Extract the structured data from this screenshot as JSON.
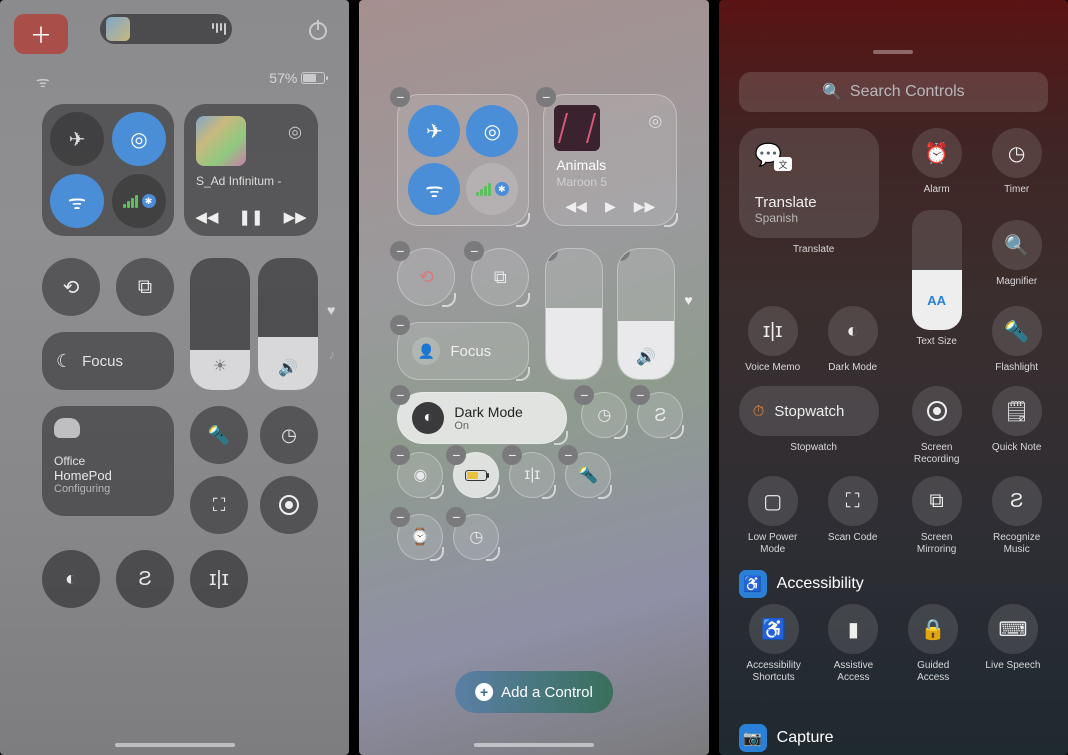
{
  "panel1": {
    "battery_percent": "57%",
    "media": {
      "title": "S_Ad Infinitum -"
    },
    "focus_label": "Focus",
    "home": {
      "room": "Office",
      "device": "HomePod",
      "status": "Configuring"
    }
  },
  "panel2": {
    "media": {
      "title": "Animals",
      "artist": "Maroon 5"
    },
    "focus_label": "Focus",
    "darkmode": {
      "title": "Dark Mode",
      "status": "On"
    },
    "add_control": "Add a Control"
  },
  "panel3": {
    "search_placeholder": "Search Controls",
    "translate": {
      "title": "Translate",
      "subtitle": "Spanish",
      "label": "Translate"
    },
    "items": {
      "alarm": "Alarm",
      "timer": "Timer",
      "magnifier": "Magnifier",
      "voice_memo": "Voice Memo",
      "dark_mode": "Dark Mode",
      "text_size": "Text Size",
      "text_size_glyph": "AA",
      "flashlight": "Flashlight",
      "stopwatch": "Stopwatch",
      "stopwatch_label": "Stopwatch",
      "screen_recording": "Screen\nRecording",
      "quick_note": "Quick Note",
      "low_power": "Low Power\nMode",
      "scan_code": "Scan Code",
      "screen_mirroring": "Screen\nMirroring",
      "recognize_music": "Recognize\nMusic"
    },
    "sections": {
      "accessibility": "Accessibility",
      "capture": "Capture"
    },
    "accessibility_items": {
      "shortcuts": "Accessibility\nShortcuts",
      "assistive": "Assistive\nAccess",
      "guided": "Guided\nAccess",
      "live_speech": "Live Speech"
    }
  }
}
